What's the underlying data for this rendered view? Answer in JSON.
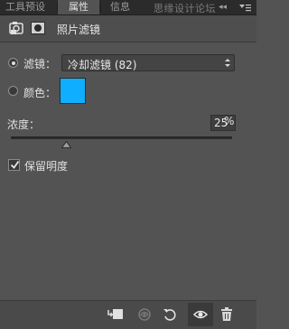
{
  "tabs": {
    "tools_preset": "工具预设",
    "properties": "属性",
    "info": "信息"
  },
  "watermark": "思缘设计论坛",
  "collapse_label": "◂◂",
  "panel": {
    "title": "照片滤镜",
    "filter_label": "滤镜：",
    "filter_value": "冷却滤镜 (82)",
    "color_label": "颜色：",
    "color_hex": "#0FAEFF",
    "density_label": "浓度：",
    "density_value": "25",
    "density_unit": "%",
    "density_level_percent": 25,
    "preserve_label": "保留明度",
    "preserve_checked": true,
    "filter_radio_selected": true
  },
  "icons": {
    "adjustment": "adjustment-layer-icon",
    "mask": "layer-mask-icon",
    "clip": "clip-to-layer-icon",
    "view_previous": "view-previous-state-icon",
    "reset": "reset-icon",
    "visibility": "eye-icon",
    "delete": "trash-icon"
  }
}
